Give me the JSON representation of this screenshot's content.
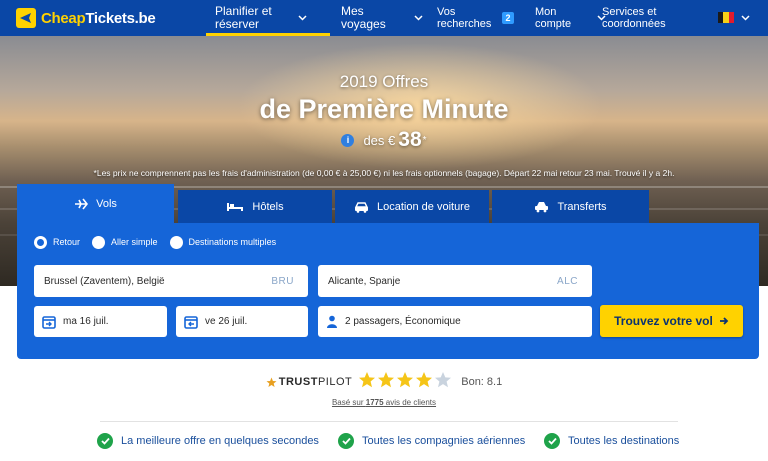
{
  "nav": {
    "logo_text_a": "Cheap",
    "logo_text_b": "Tickets.be",
    "items": [
      {
        "label": "Planifier et\nréserver"
      },
      {
        "label": "Mes\nvoyages"
      },
      {
        "label": "Vos\nrecherches"
      },
      {
        "label": "Mon\ncompte"
      },
      {
        "label": "Services et\ncoordonnées"
      }
    ],
    "recent_count": "2",
    "flag_colors": [
      "#1a1a1a",
      "#f7d117",
      "#e21b2e"
    ]
  },
  "hero": {
    "kicker": "2019 Offres",
    "title": "de Première Minute",
    "info_glyph": "i",
    "price_prefix": "des €",
    "price_value": "38",
    "price_sup": "*",
    "note": "*Les prix ne comprennent pas les frais d'administration (de 0,00 € à 25,00 €) ni les frais optionnels (bagage). Départ 22 mai retour 23 mai. Trouvé il y a 2h."
  },
  "tabs": [
    {
      "label": "Vols",
      "icon": "plane-icon"
    },
    {
      "label": "Hôtels",
      "icon": "bed-icon"
    },
    {
      "label": "Location de voiture",
      "icon": "car-icon"
    },
    {
      "label": "Transferts",
      "icon": "shuttle-icon"
    }
  ],
  "search": {
    "trip_types": [
      "Retour",
      "Aller simple",
      "Destinations multiples"
    ],
    "selected_trip_type": "Retour",
    "origin": {
      "value": "Brussel (Zaventem), België",
      "code": "BRU"
    },
    "destination": {
      "value": "Alicante, Spanje",
      "code": "ALC"
    },
    "depart_date": "ma 16 juil.",
    "return_date": "ve 26 juil.",
    "passengers": "2 passagers, Économique",
    "submit_label": "Trouvez votre vol"
  },
  "trust": {
    "brand_bold": "TRUST",
    "brand_rest": "PILOT",
    "stars_filled": 4,
    "stars_total": 5,
    "score_text": "Bon: 8.1",
    "reviews_prefix": "Basé sur ",
    "reviews_count": "1775",
    "reviews_suffix": " avis de clients"
  },
  "features": [
    "La meilleure offre en quelques secondes",
    "Toutes les compagnies aériennes",
    "Toutes les destinations"
  ],
  "colors": {
    "nav_bg": "#0a47a6",
    "panel_bg": "#1565d8",
    "accent_yellow": "#ffd200",
    "check_green": "#1fa34a",
    "star_on": "#f5c518",
    "star_off": "#c9d3de"
  }
}
